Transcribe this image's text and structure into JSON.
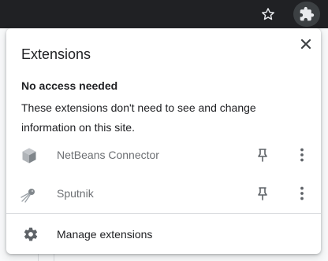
{
  "toolbar": {
    "bookmark_icon": "star-outline-icon",
    "extensions_icon": "puzzle-piece-icon"
  },
  "popup": {
    "title": "Extensions",
    "close_icon": "close-icon",
    "section": {
      "heading": "No access needed",
      "description": "These extensions don't need to see and change information on this site."
    },
    "extensions": [
      {
        "name": "NetBeans Connector",
        "icon": "netbeans-cube-icon",
        "pin_icon": "pin-icon",
        "more_icon": "more-vertical-icon"
      },
      {
        "name": "Sputnik",
        "icon": "sputnik-satellite-icon",
        "pin_icon": "pin-icon",
        "more_icon": "more-vertical-icon"
      }
    ],
    "manage": {
      "label": "Manage extensions",
      "icon": "gear-icon"
    }
  },
  "colors": {
    "toolbar_bg": "#202124",
    "text_primary": "#202124",
    "text_muted": "#6c6f73",
    "icon_gray": "#5f6368"
  }
}
